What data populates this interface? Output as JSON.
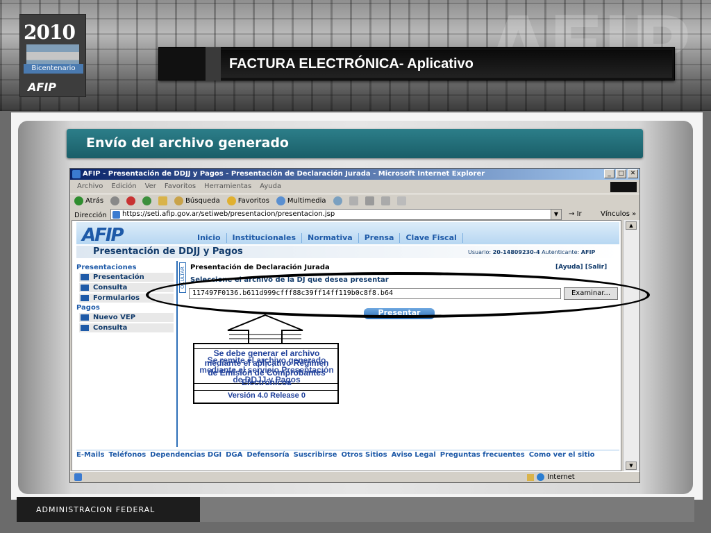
{
  "header": {
    "logo_year": "2010",
    "logo_label": "Bicentenario",
    "logo_brand": "AFIP",
    "title": "FACTURA ELECTRÓNICA-  Aplicativo"
  },
  "section": {
    "title": "Envío del archivo generado"
  },
  "browser": {
    "title": "AFIP - Presentación de DDJJ y Pagos - Presentación de Declaración Jurada - Microsoft Internet Explorer",
    "menu": [
      "Archivo",
      "Edición",
      "Ver",
      "Favoritos",
      "Herramientas",
      "Ayuda"
    ],
    "toolbar": {
      "back": "Atrás",
      "search": "Búsqueda",
      "favorites": "Favoritos",
      "multimedia": "Multimedia"
    },
    "address_label": "Dirección",
    "address_value": "https://seti.afip.gov.ar/setiweb/presentacion/presentacion.jsp",
    "go_label": "Ir",
    "links_label": "Vínculos",
    "status_zone": "Internet"
  },
  "page": {
    "brand": "AFIP",
    "nav": [
      "Inicio",
      "Institucionales",
      "Normativa",
      "Prensa",
      "Clave Fiscal"
    ],
    "section_title": "Presentación de DDJJ y Pagos",
    "user_label": "Usuario:",
    "user_value": "20-14809230-4",
    "auth_label": "Autenticante:",
    "auth_value": "AFIP",
    "side": {
      "presentaciones": "Presentaciones",
      "items1": [
        "Presentación",
        "Consulta",
        "Formularios"
      ],
      "pagos": "Pagos",
      "items2": [
        "Nuevo VEP",
        "Consulta"
      ]
    },
    "ocultar": "OCULTAR",
    "form_title": "Presentación de Declaración Jurada",
    "help_links": "[Ayuda]  [Salir]",
    "select_label": "Seleccione el archivo de la DJ que desea presentar",
    "file_value": "117497F0136.b611d999cfff88c39ff14ff119b0c8f8.b64",
    "browse_button": "Examinar...",
    "submit_button": "Presentar",
    "footer_links": [
      "E-Mails",
      "Teléfonos",
      "Dependencias DGI",
      "DGA",
      "Defensoría",
      "Suscribirse",
      "Otros Sitios",
      "Aviso Legal",
      "Preguntas frecuentes",
      "Como ver el sitio"
    ]
  },
  "callout": {
    "text1": "Se debe generar el archivo mediante el aplicativo Régimen de Emisión de Comprobantes Electrónicos",
    "text2": "Se remite el archivo generado mediante el servicio Presentación de DDJJ y Pagos",
    "version": "Versión 4.0 Release 0"
  },
  "footer": {
    "label": "ADMINISTRACION FEDERAL"
  }
}
